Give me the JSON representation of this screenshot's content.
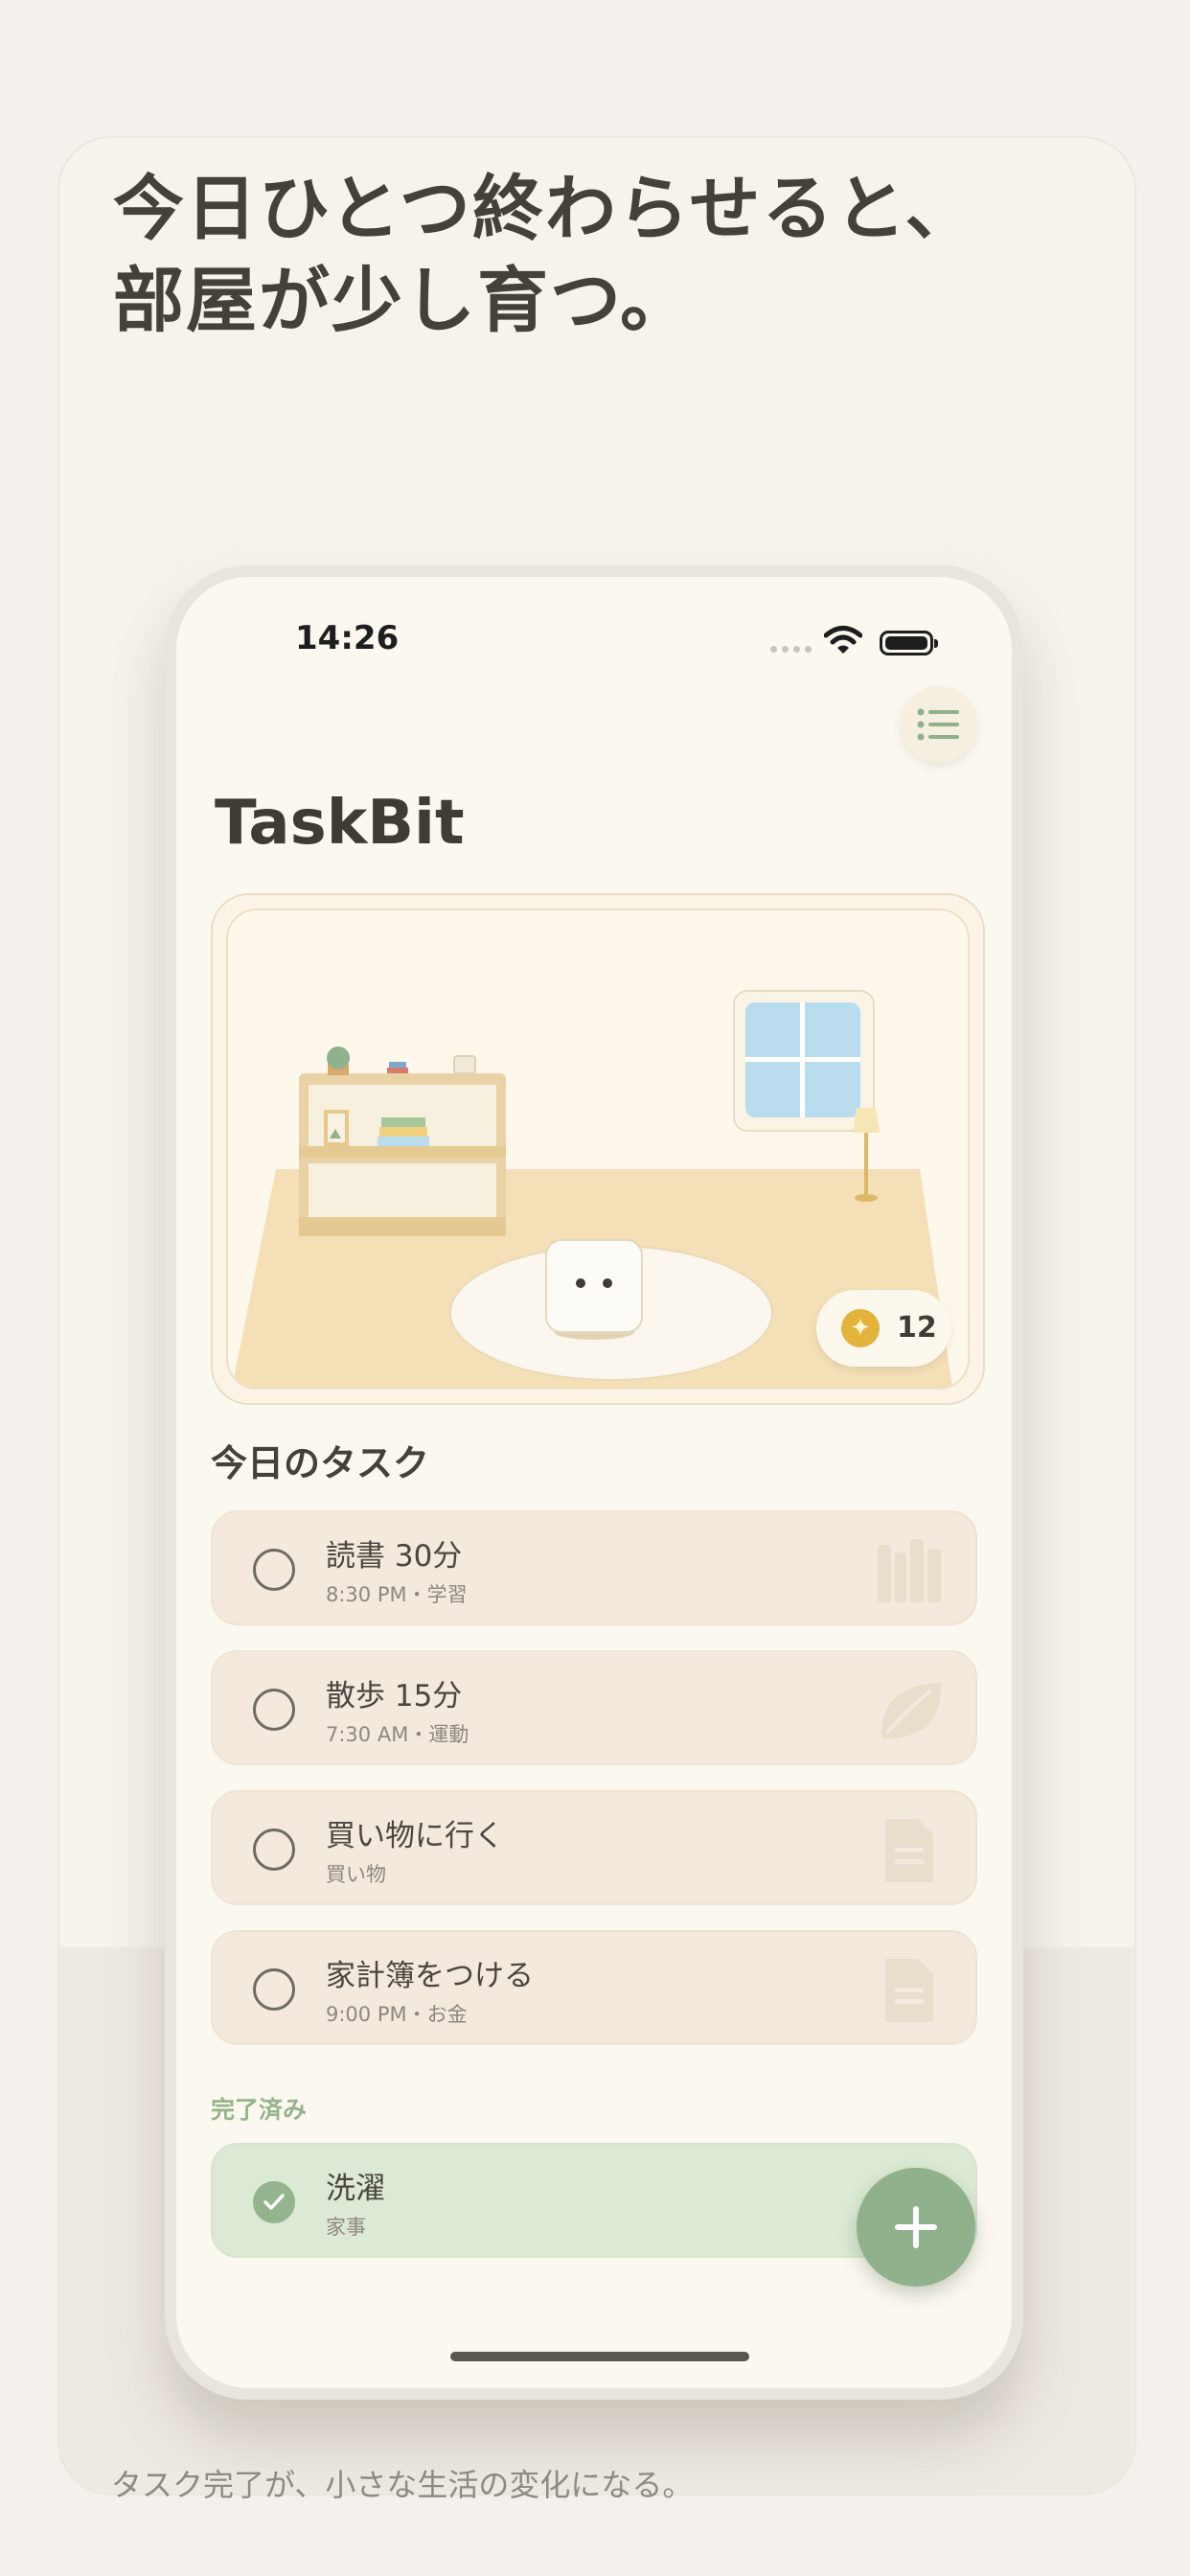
{
  "headline": [
    "今日ひとつ終わらせると、",
    "部屋が少し育つ。"
  ],
  "caption": "タスク完了が、小さな生活の変化になる。",
  "status_bar": {
    "time": "14:26"
  },
  "app": {
    "title": "TaskBit"
  },
  "room": {
    "coins": "12"
  },
  "today": {
    "section_title": "今日のタスク",
    "tasks": [
      {
        "title": "読書 30分",
        "meta": "8:30 PM・学習",
        "icon": "books-icon"
      },
      {
        "title": "散歩 15分",
        "meta": "7:30 AM・運動",
        "icon": "leaf-icon"
      },
      {
        "title": "買い物に行く",
        "meta": "買い物",
        "icon": "document-icon"
      },
      {
        "title": "家計簿をつける",
        "meta": "9:00 PM・お金",
        "icon": "document-icon"
      }
    ]
  },
  "completed": {
    "section_title": "完了済み",
    "tasks": [
      {
        "title": "洗濯",
        "meta": "家事"
      }
    ]
  },
  "colors": {
    "accent_green": "#8fb18b",
    "coin_gold": "#e4b33c",
    "task_bg": "#f3e9dd"
  }
}
